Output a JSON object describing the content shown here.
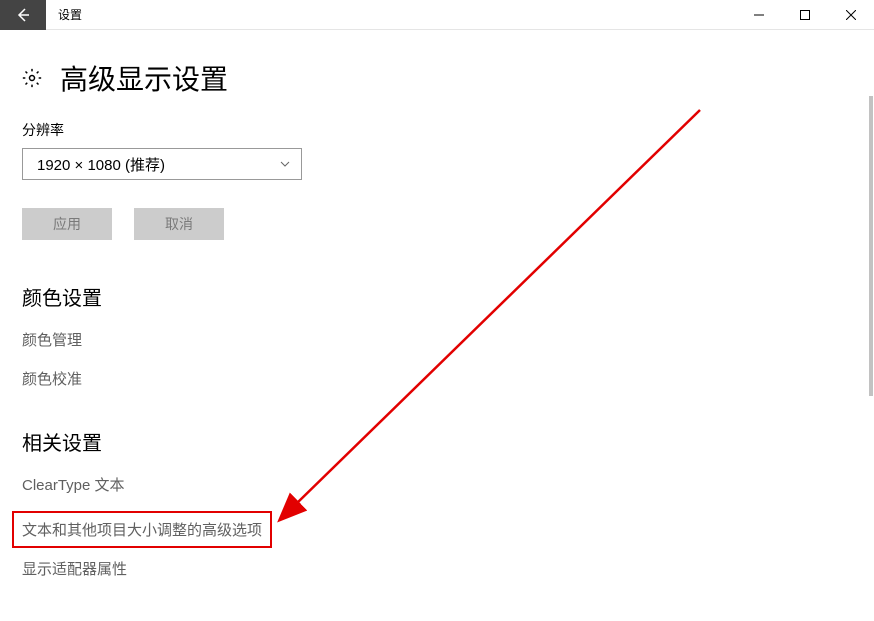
{
  "titlebar": {
    "app_title": "设置"
  },
  "page": {
    "heading": "高级显示设置"
  },
  "resolution": {
    "label": "分辨率",
    "selected": "1920 × 1080 (推荐)"
  },
  "buttons": {
    "apply": "应用",
    "cancel": "取消"
  },
  "color_section": {
    "heading": "颜色设置",
    "link_management": "颜色管理",
    "link_calibration": "颜色校准"
  },
  "related_section": {
    "heading": "相关设置",
    "link_cleartype": "ClearType 文本",
    "link_text_sizing": "文本和其他项目大小调整的高级选项",
    "link_adapter": "显示适配器属性"
  }
}
